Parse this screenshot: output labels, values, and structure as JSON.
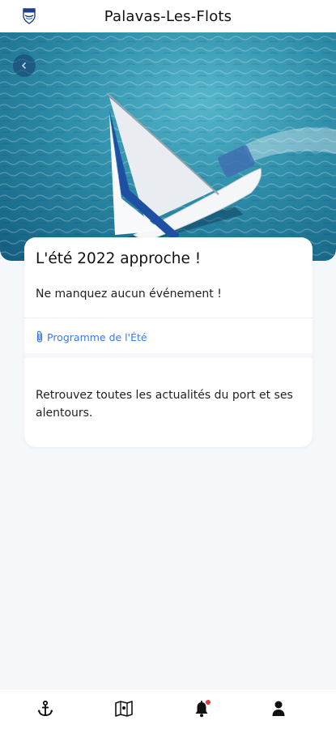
{
  "header": {
    "title": "Palavas-Les-Flots",
    "logo_icon": "coat-of-arms-icon"
  },
  "hero": {
    "image": "sailboat-aerial-photo",
    "back_icon": "chevron-left-icon"
  },
  "card": {
    "title": "L'été 2022 approche !",
    "subtitle": "Ne manquez aucun événement !",
    "attachment_label": "Programme de l'Été",
    "attachment_icon": "paperclip-icon",
    "body": "Retrouvez toutes les actualités du port et ses alentours."
  },
  "bottom_nav": {
    "items": [
      {
        "icon": "anchor-icon"
      },
      {
        "icon": "map-icon"
      },
      {
        "icon": "bell-icon",
        "badge": true
      },
      {
        "icon": "user-icon"
      }
    ]
  },
  "colors": {
    "accent": "#3a7be0",
    "background": "#f5f8fb",
    "sea": "#2a8aa5",
    "badge": "#e53935"
  }
}
